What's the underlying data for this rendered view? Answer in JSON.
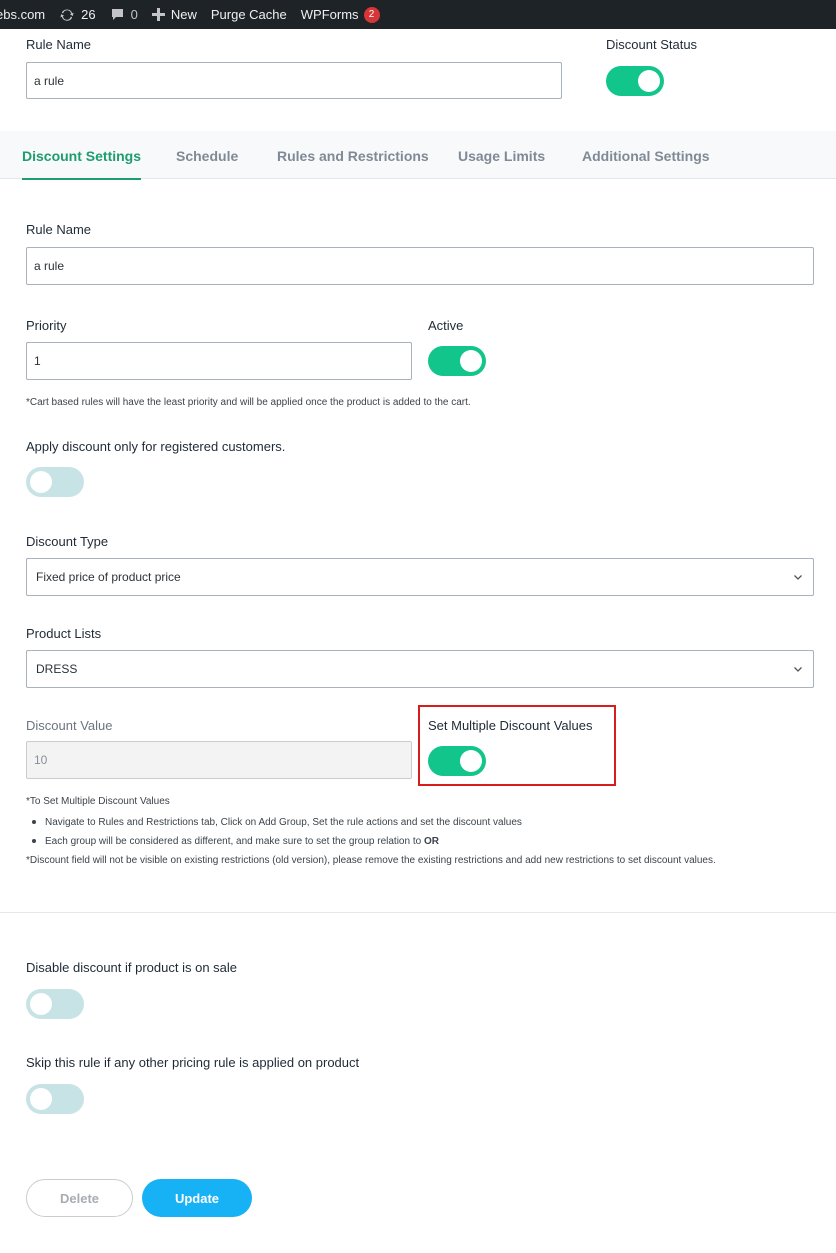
{
  "adminbar": {
    "site": "ebs.com",
    "updates_count": "26",
    "comments_count": "0",
    "new_label": "New",
    "purge_label": "Purge Cache",
    "wpforms_label": "WPForms",
    "wpforms_badge": "2"
  },
  "header": {
    "rule_name_label": "Rule Name",
    "rule_name_value": "a rule",
    "discount_status_label": "Discount Status",
    "discount_status_on": true
  },
  "tabs": [
    {
      "label": "Discount Settings",
      "active": true
    },
    {
      "label": "Schedule",
      "active": false
    },
    {
      "label": "Rules and Restrictions",
      "active": false
    },
    {
      "label": "Usage Limits",
      "active": false
    },
    {
      "label": "Additional Settings",
      "active": false
    }
  ],
  "form": {
    "rule_name_label": "Rule Name",
    "rule_name_value": "a rule",
    "priority_label": "Priority",
    "priority_value": "1",
    "active_label": "Active",
    "priority_note": "*Cart based rules will have the least priority and will be applied once the product is added to the cart.",
    "registered_label": "Apply discount only for registered customers.",
    "discount_type_label": "Discount Type",
    "discount_type_value": "Fixed price of product price",
    "product_lists_label": "Product Lists",
    "product_lists_value": "DRESS",
    "discount_value_label": "Discount Value",
    "discount_value_value": "10",
    "multiple_label": "Set Multiple Discount Values",
    "multi_note_title": "*To Set Multiple Discount Values",
    "multi_note_items": [
      "Navigate to Rules and Restrictions tab, Click on Add Group, Set the rule actions and set the discount values",
      "Each group will be considered as different, and make sure to set the group relation to "
    ],
    "multi_note_or": "OR",
    "multi_note_footer": "*Discount field will not be visible on existing restrictions (old version), please remove the existing restrictions and add new restrictions to set discount values.",
    "disable_sale_label": "Disable discount if product is on sale",
    "skip_rule_label": "Skip this rule if any other pricing rule is applied on product"
  },
  "buttons": {
    "delete_label": "Delete",
    "update_label": "Update"
  },
  "colors": {
    "toggle_on": "#12c58a",
    "toggle_off": "#c8e3e6",
    "tab_active": "#1e9d6d",
    "update_button": "#17b1f5",
    "highlight_box": "#d81d1d"
  }
}
